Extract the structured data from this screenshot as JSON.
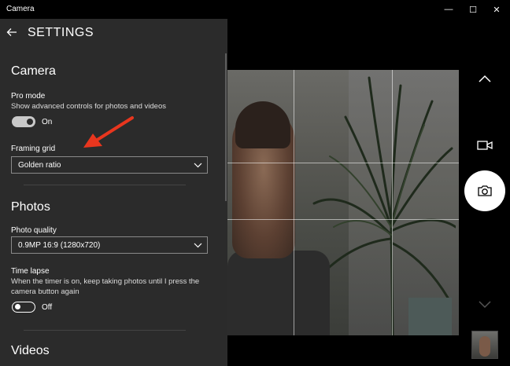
{
  "window": {
    "title": "Camera",
    "minimize_glyph": "—",
    "maximize_glyph": "☐",
    "close_glyph": "✕"
  },
  "settings": {
    "title": "SETTINGS",
    "camera_section": {
      "title": "Camera",
      "pro_mode": {
        "label": "Pro mode",
        "description": "Show advanced controls for photos and videos",
        "state": "On"
      },
      "framing_grid": {
        "label": "Framing grid",
        "value": "Golden ratio"
      }
    },
    "photos_section": {
      "title": "Photos",
      "photo_quality": {
        "label": "Photo quality",
        "value": "0.9MP 16:9 (1280x720)"
      },
      "time_lapse": {
        "label": "Time lapse",
        "description": "When the timer is on, keep taking photos until I press the camera button again",
        "state": "Off"
      }
    },
    "videos_section": {
      "title": "Videos"
    }
  },
  "colors": {
    "panel_bg": "#2b2b2b",
    "annotation_arrow": "#e8361e",
    "window_bg": "#000000"
  },
  "icons": {
    "back": "back-arrow-icon",
    "chevron_up": "chevron-up-icon",
    "chevron_down": "chevron-down-icon",
    "video_mode": "video-camera-icon",
    "shutter": "camera-icon"
  }
}
